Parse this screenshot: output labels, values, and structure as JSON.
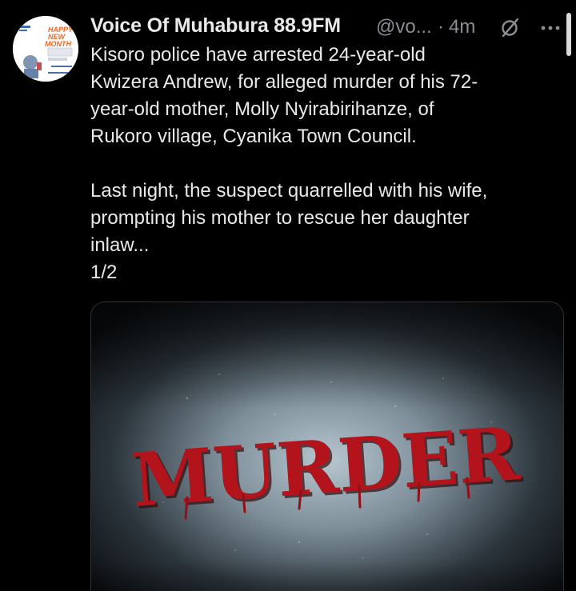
{
  "tweet": {
    "display_name": "Voice Of Muhabura 88.9FM",
    "handle": "@vo...",
    "separator": "·",
    "time": "4m",
    "paragraph1": "Kisoro police have arrested 24-year-old\nKwizera Andrew, for alleged murder of his 72-\nyear-old mother, Molly Nyirabirihanze, of\nRukoro village, Cyanika Town Council.",
    "paragraph2": "Last night, the suspect quarrelled with his wife,\nprompting his mother to rescue her daughter\ninlaw...\n1/2",
    "media_word": "MURDER"
  },
  "avatar": {
    "text_line1": "HAPPY",
    "text_line2": "NEW",
    "text_line3": "MONTH"
  },
  "icons": {
    "grok": "grok-icon",
    "more": "more-icon"
  },
  "colors": {
    "background": "#000000",
    "primary_text": "#e7e9ea",
    "secondary_text": "#8b8f94",
    "media_word": "#b3141b",
    "avatar_accent": "#f26522"
  }
}
